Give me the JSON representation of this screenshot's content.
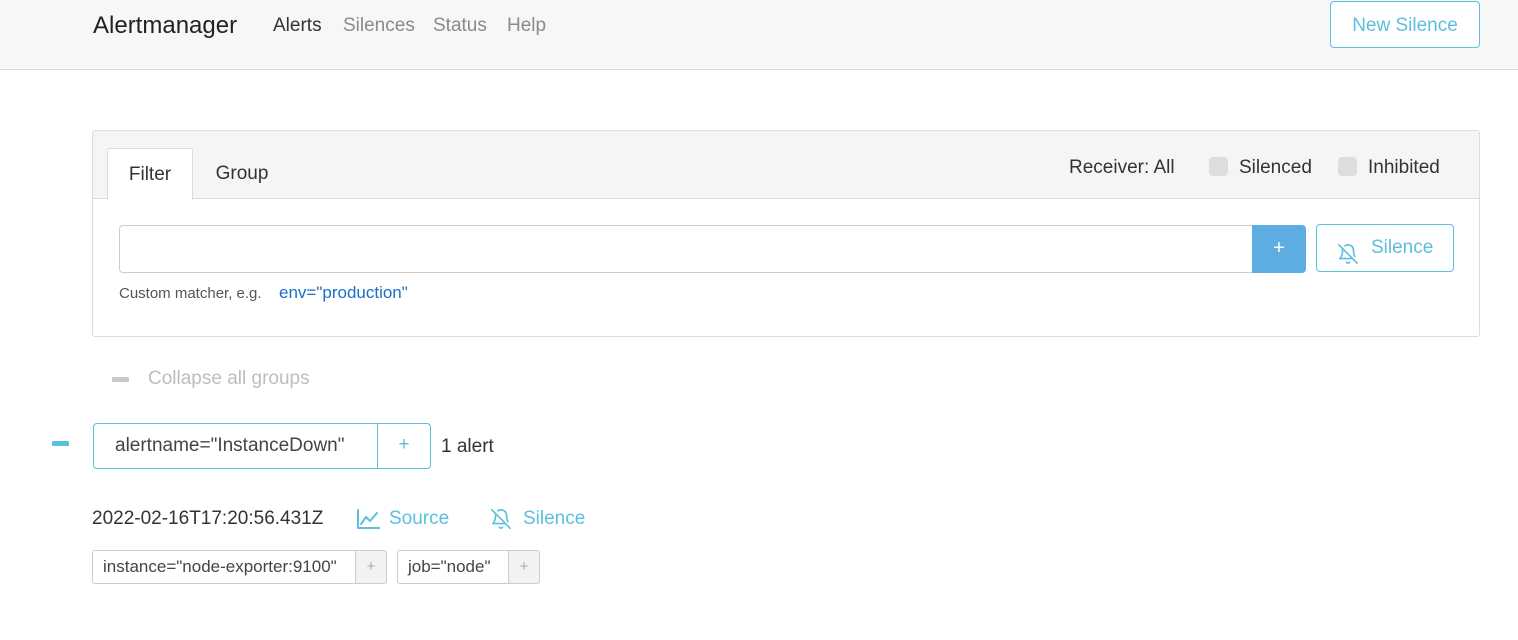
{
  "navbar": {
    "brand": "Alertmanager",
    "links": [
      {
        "label": "Alerts",
        "active": true
      },
      {
        "label": "Silences",
        "active": false
      },
      {
        "label": "Status",
        "active": false
      },
      {
        "label": "Help",
        "active": false
      }
    ],
    "new_silence_label": "New Silence"
  },
  "filter": {
    "tabs": [
      "Filter",
      "Group"
    ],
    "receiver_label": "Receiver: All",
    "checkboxes": [
      {
        "label": "Silenced",
        "checked": false
      },
      {
        "label": "Inhibited",
        "checked": false
      }
    ],
    "input_value": "",
    "add_label": "+",
    "silence_label": "Silence",
    "hint_text": "Custom matcher, e.g.",
    "hint_example": "env=\"production\""
  },
  "collapse_all_label": "Collapse all groups",
  "groups": [
    {
      "label": "alertname=\"InstanceDown\"",
      "add_label": "+",
      "count_label": "1 alert",
      "alerts": [
        {
          "timestamp": "2022-02-16T17:20:56.431Z",
          "source_label": "Source",
          "silence_label": "Silence",
          "labels": [
            {
              "text": "instance=\"node-exporter:9100\"",
              "add": "+"
            },
            {
              "text": "job=\"node\"",
              "add": "+"
            }
          ]
        }
      ]
    }
  ],
  "icons": {
    "chart": "chart-line-icon",
    "bell_slash": "bell-slash-icon",
    "minus": "minus-icon"
  },
  "colors": {
    "accent": "#5bc0de",
    "primary_button": "#5dade2",
    "link_example": "#1a6fc9"
  }
}
